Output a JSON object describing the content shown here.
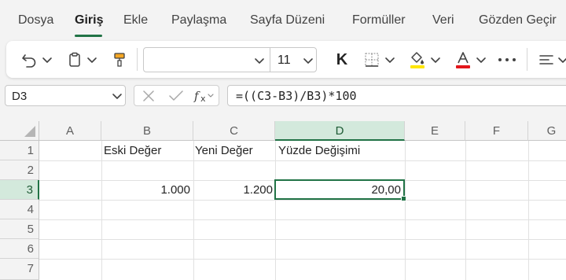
{
  "menu": {
    "tabs": [
      "Dosya",
      "Giriş",
      "Ekle",
      "Paylaşma",
      "Sayfa Düzeni",
      "Formüller",
      "Veri",
      "Gözden Geçir"
    ],
    "active": "Giriş"
  },
  "toolbar": {
    "font_name": "",
    "font_size": "11",
    "bold_label": "K",
    "icons": [
      "undo-icon",
      "clipboard-icon",
      "format-painter-icon",
      "borders-icon",
      "fill-color-icon",
      "font-color-icon",
      "more-icon",
      "align-icon"
    ],
    "colors": {
      "fill_color": "#ffe600",
      "font_color": "#e3161b",
      "accent": "#217346"
    }
  },
  "formula_bar": {
    "name_box": "D3",
    "formula": "=((C3-B3)/B3)*100"
  },
  "sheet": {
    "columns": [
      "A",
      "B",
      "C",
      "D",
      "E",
      "F",
      "G"
    ],
    "rows": [
      "1",
      "2",
      "3",
      "4",
      "5",
      "6",
      "7"
    ],
    "selected_column": "D",
    "selected_row": "3",
    "cells": {
      "B1": "Eski Değer",
      "C1": "Yeni Değer",
      "D1": "Yüzde Değişimi",
      "B3": "1.000",
      "C3": "1.200",
      "D3": "20,00"
    }
  }
}
